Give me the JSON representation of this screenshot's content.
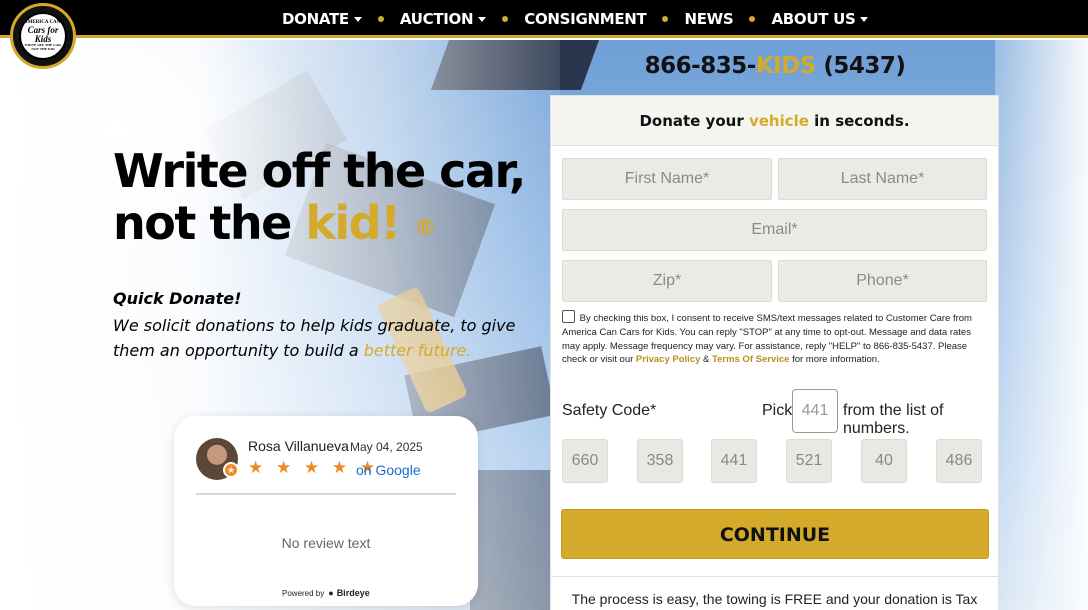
{
  "logo": {
    "top_text": "AMERICA CAN!",
    "script_text": "Cars for Kids",
    "bottom_text": "WRITE OFF THE CAR, NOT THE KID"
  },
  "nav": {
    "items": [
      {
        "label": "DONATE",
        "dropdown": true
      },
      {
        "label": "AUCTION",
        "dropdown": true
      },
      {
        "label": "CONSIGNMENT",
        "dropdown": false
      },
      {
        "label": "NEWS",
        "dropdown": false
      },
      {
        "label": "ABOUT US",
        "dropdown": true
      }
    ]
  },
  "hero": {
    "line1": "Write off the car,",
    "line2_prefix": "not the ",
    "line2_gold": "kid!",
    "registered": "®",
    "quick": "Quick Donate!",
    "solicit_text": "We solicit donations to help kids graduate, to give them an opportunity to build a ",
    "solicit_gold": "better future."
  },
  "review": {
    "name": "Rosa Villanueva",
    "date": "May 04, 2025",
    "stars": "★ ★ ★ ★ ★",
    "rating": 5,
    "source": "on Google",
    "body": "No review text",
    "powered_by": "Powered by",
    "brand": "Birdeye"
  },
  "phone": {
    "prefix": "866-835-",
    "gold": "KIDS",
    "suffix": " (5437)"
  },
  "form": {
    "heading_prefix": "Donate your ",
    "heading_gold": "vehicle",
    "heading_suffix": " in seconds.",
    "first_name_placeholder": "First Name*",
    "last_name_placeholder": "Last Name*",
    "email_placeholder": "Email*",
    "zip_placeholder": "Zip*",
    "phone_placeholder": "Phone*",
    "consent_text": "By checking this box, I consent to receive SMS/text messages related to Customer Care from America Can Cars for Kids. You can reply \"STOP\" at any time to opt-out. Message and data rates may apply. Message frequency may vary. For assistance, reply \"HELP\" to 866-835-5437.  Please check or visit our ",
    "privacy_link": "Privacy Policy",
    "amp": " & ",
    "terms_link": "Terms Of Service",
    "consent_end": " for more information.",
    "safety_label": "Safety Code*",
    "pick_label": "Pick",
    "pick_value": "441",
    "from_label": "from the list of numbers.",
    "codes": [
      "660",
      "358",
      "441",
      "521",
      "40",
      "486"
    ],
    "continue_label": "CONTINUE",
    "process_text": "The process is easy, the towing is FREE and your donation is Tax Deductible."
  },
  "colors": {
    "gold": "#d4aa2b",
    "nav_bg": "#000000",
    "google_blue": "#1a6fd1",
    "star_orange": "#f08a24"
  }
}
